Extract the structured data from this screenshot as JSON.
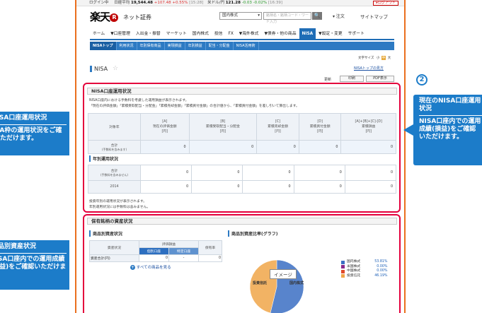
{
  "ticker": {
    "login_label": "ログイン中",
    "nikkei_label": "日経平均",
    "nikkei_value": "19,544.48",
    "nikkei_change": "+107.48",
    "nikkei_pct": "+0.55%",
    "nikkei_time": "[15:28]",
    "usdjpy_label": "米ドル/円",
    "usdjpy_value": "121.28",
    "usdjpy_change": "-0.03",
    "usdjpy_pct": "-0.02%",
    "usdjpy_time": "[16:39]",
    "logout": "ログアウト"
  },
  "header": {
    "logo_text": "楽天",
    "logo_r": "R",
    "brand": "ネット証券",
    "market_select": "国内株式",
    "search_placeholder": "銘柄名・銘柄コード・ワード入力",
    "search_button": "🔍",
    "favorites": "注文",
    "sitemap": "サイトマップ"
  },
  "nav": {
    "items": [
      "ホーム",
      "▼口座管理",
      "入出金・振替",
      "マーケット",
      "国内株式",
      "投信",
      "FX",
      "▼海外株式",
      "▼債券・他の商品",
      "NISA",
      "▼設定・変更",
      "サポート"
    ],
    "active": "NISA"
  },
  "subnav": {
    "items": [
      "NISAトップ",
      "利用状況",
      "年別保有商品",
      "実現損益",
      "年別損益",
      "配当・分配金",
      "NISA活用術"
    ],
    "active": "NISAトップ"
  },
  "fontsize": {
    "label": "文字サイズ",
    "small": "小",
    "medium": "中",
    "large": "大"
  },
  "page": {
    "title": "NISA",
    "star": "☆",
    "nisa_top_link": "NISAトップの見方",
    "update": "更新",
    "print": "印刷",
    "pdf": "PDF表示"
  },
  "usage": {
    "title": "NISA口座運用状況",
    "note1": "NISA口座内における手数料を考慮した運用損益が表示されます。",
    "note2": "「現在の評価金額」「累積受取配当・分配金」「累積売却金額」「累積買付金額」の合計値から、「累積買付金額」を差し引いて算出します。",
    "col_target": "対象年",
    "cols": [
      {
        "code": "[A]",
        "name": "現在の評価金額",
        "unit": "[円]"
      },
      {
        "code": "[B]",
        "name": "累積受取配当・分配金",
        "unit": "[円]"
      },
      {
        "code": "[C]",
        "name": "累積売却金額",
        "unit": "[円]"
      },
      {
        "code": "[D]",
        "name": "累積買付金額",
        "unit": "[円]"
      },
      {
        "code": "[A]+[B]+[C]-[D]",
        "name": "累積損益",
        "unit": "[円]"
      }
    ],
    "total_label": "合計",
    "total_sub": "(手数料を含みます)",
    "total_values": [
      "0",
      "0",
      "0",
      "0",
      "0"
    ],
    "yearly_title": "年別運用状況",
    "yearly_total_label": "合計",
    "yearly_total_sub": "(手数料を含みません)",
    "yearly_total_values": [
      "0",
      "0",
      "0",
      "0",
      "0"
    ],
    "year": "2014",
    "year_values": [
      "0",
      "0",
      "0",
      "0",
      "0"
    ],
    "foot1": "投資年別の運用状況が表示されます。",
    "foot2": "年別運用状況には手数料は含みません。"
  },
  "holdings": {
    "title": "保有銘柄の資産状況",
    "product_title": "商品別資産状況",
    "ratio_title": "商品別資産比率(グラフ)",
    "col_asset": "資産状況",
    "col_eval": "評価損益",
    "col_eval_a": "個別口座",
    "col_eval_b": "特定口座",
    "col_hold": "保有率",
    "row_label": "資産合計(円)",
    "row_value": "0",
    "row_dash": "-",
    "row_hold": "0",
    "see_all": "すべての商品を見る",
    "image_label": "イメージ",
    "pie_label_left": "投資信託",
    "pie_label_right": "国内株式"
  },
  "chart_data": {
    "type": "pie",
    "categories": [
      "国内株式",
      "米国株式",
      "中国株式",
      "投資信託"
    ],
    "values": [
      53.81,
      0.0,
      0.0,
      46.19
    ],
    "value_labels": [
      "53.81%",
      "0.00%",
      "0.00%",
      "46.19%"
    ],
    "colors": [
      "#3c6fc4",
      "#8b2b8b",
      "#e04a2b",
      "#f0a64a"
    ],
    "title": "イメージ"
  },
  "callouts": {
    "left1_title": "NISA口座運用状況",
    "left1_body": "NISA枠の運用状況をご確認いただけます。",
    "right_num": "2",
    "right_title": "現在のNISA口座運用状況",
    "right_body": "NISA口座内での運用成績(損益)をご確認いただけます。",
    "left2_title": "商品別資産状況",
    "left2_body": "NISA口座内での運用成績(損益)をご確認いただけます。"
  }
}
